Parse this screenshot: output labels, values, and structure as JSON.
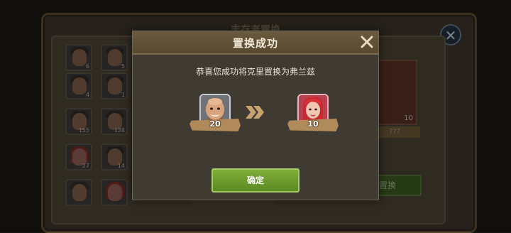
{
  "background": {
    "title": "丰存者置换",
    "close_icon": "close-icon",
    "grid_counts": [
      "6",
      "5",
      "4",
      "1",
      "155",
      "128",
      "27",
      "14",
      "",
      ""
    ],
    "right_card_count": "10",
    "right_card_label": "???",
    "right_button_label": "置换"
  },
  "modal": {
    "title": "置换成功",
    "close_icon": "close-x-icon",
    "message": "恭喜您成功将克里置换为弗兰兹",
    "from_hero": {
      "level": "20",
      "portrait": "bald-man-portrait"
    },
    "arrow_icon": "double-chevron-right-icon",
    "to_hero": {
      "level": "10",
      "portrait": "red-hair-woman-portrait"
    },
    "confirm_label": "确定"
  },
  "colors": {
    "header": "#5f5036",
    "confirm_green": "#6c9c2e",
    "ribbon": "#b08a5a",
    "arrow": "#c7a270"
  }
}
